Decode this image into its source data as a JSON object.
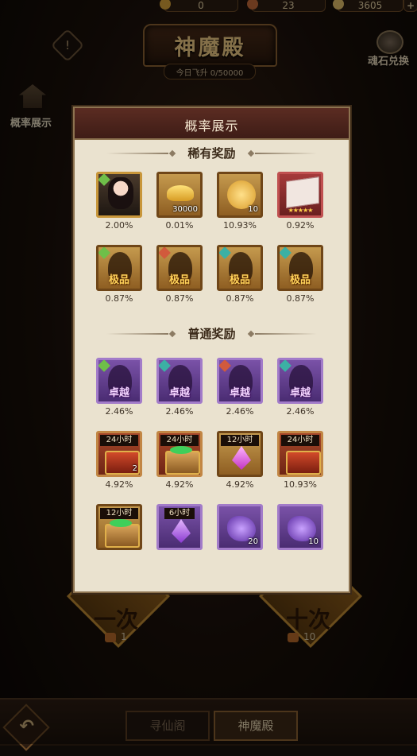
{
  "topbar": {
    "resources": [
      {
        "icon": "gold-icon",
        "value": "0"
      },
      {
        "icon": "coin-icon",
        "value": "23"
      },
      {
        "icon": "ingot-icon",
        "value": "3605"
      }
    ],
    "add_label": "+"
  },
  "header": {
    "title": "神魔殿",
    "subtitle": "今日飞升 0/50000",
    "info_label": "!",
    "exchange_label": "魂石兑换",
    "prob_label": "概率展示"
  },
  "draw_buttons": [
    {
      "text": "一次",
      "cost": "1"
    },
    {
      "text": "十次",
      "cost": "10"
    }
  ],
  "bottom": {
    "back_label": "↶",
    "tabs": [
      {
        "label": "寻仙阁",
        "active": false
      },
      {
        "label": "神魔殿",
        "active": true
      }
    ]
  },
  "modal": {
    "title": "概率展示",
    "rare_section": {
      "title": "稀有奖励",
      "items": [
        {
          "kind": "hero",
          "qty": "",
          "tag": "",
          "pct": "2.00%"
        },
        {
          "kind": "ingot",
          "qty": "30000",
          "tag": "",
          "pct": "0.01%"
        },
        {
          "kind": "coin",
          "qty": "10",
          "tag": "",
          "pct": "10.93%"
        },
        {
          "kind": "book",
          "qty": "",
          "tag": "",
          "pct": "0.92%"
        },
        {
          "kind": "fragment-gold",
          "badge": "g",
          "grade": "极品",
          "pct": "0.87%"
        },
        {
          "kind": "fragment-gold",
          "badge": "r",
          "grade": "极品",
          "pct": "0.87%"
        },
        {
          "kind": "fragment-gold",
          "badge": "t",
          "grade": "极品",
          "pct": "0.87%"
        },
        {
          "kind": "fragment-gold",
          "badge": "t",
          "grade": "极品",
          "pct": "0.87%"
        }
      ]
    },
    "normal_section": {
      "title": "普通奖励",
      "items": [
        {
          "kind": "fragment-purple",
          "badge": "g",
          "grade": "卓越",
          "pct": "2.46%"
        },
        {
          "kind": "fragment-purple",
          "badge": "t",
          "grade": "卓越",
          "pct": "2.46%"
        },
        {
          "kind": "fragment-purple",
          "badge": "r",
          "grade": "卓越",
          "pct": "2.46%"
        },
        {
          "kind": "fragment-purple",
          "badge": "t",
          "grade": "卓越",
          "pct": "2.46%"
        },
        {
          "kind": "chest-red",
          "tag": "24小时",
          "qty": "2",
          "pct": "4.92%"
        },
        {
          "kind": "chest-green",
          "tag": "24小时",
          "qty": "",
          "pct": "4.92%"
        },
        {
          "kind": "crystal",
          "tag": "12小时",
          "qty": "",
          "pct": "4.92%"
        },
        {
          "kind": "chest-red",
          "tag": "24小时",
          "qty": "",
          "pct": "10.93%"
        },
        {
          "kind": "chest-green",
          "tag": "12小时",
          "qty": "",
          "pct": ""
        },
        {
          "kind": "crystal-purple",
          "tag": "6小时",
          "qty": "",
          "pct": ""
        },
        {
          "kind": "stone",
          "tag": "",
          "qty": "20",
          "pct": ""
        },
        {
          "kind": "stone",
          "tag": "",
          "qty": "10",
          "pct": ""
        }
      ]
    }
  },
  "colors": {
    "modal_bg": "#eae2cf",
    "modal_header": "#4a221a",
    "gold_frame": "#c59a4e",
    "purple_frame": "#7a52a8"
  }
}
